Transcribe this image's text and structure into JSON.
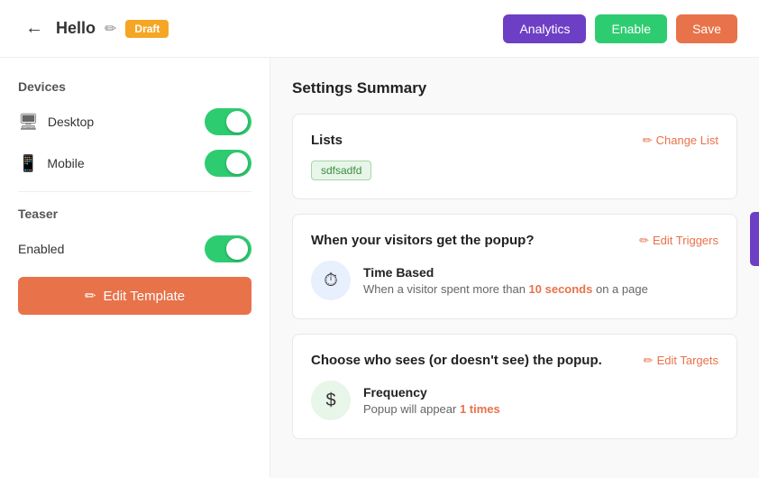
{
  "header": {
    "back_label": "←",
    "title": "Hello",
    "pencil_icon": "✏",
    "draft_badge": "Draft",
    "analytics_label": "Analytics",
    "enable_label": "Enable",
    "save_label": "Save"
  },
  "sidebar": {
    "devices_title": "Devices",
    "desktop_label": "Desktop",
    "mobile_label": "Mobile",
    "teaser_title": "Teaser",
    "teaser_enabled_label": "Enabled",
    "edit_template_label": "Edit Template",
    "pencil_icon": "✏"
  },
  "main": {
    "settings_title": "Settings Summary",
    "lists_card": {
      "title": "Lists",
      "action_label": "Change List",
      "action_icon": "✏",
      "tag": "sdfsadfd"
    },
    "trigger_card": {
      "title": "When your visitors get the popup?",
      "action_label": "Edit Triggers",
      "action_icon": "✏",
      "trigger_name": "Time Based",
      "trigger_desc_prefix": "When a visitor spent more than ",
      "trigger_highlight": "10 seconds",
      "trigger_desc_suffix": " on a page",
      "trigger_icon": "⏱"
    },
    "target_card": {
      "title": "Choose who sees (or doesn't see) the popup.",
      "action_label": "Edit Targets",
      "action_icon": "✏",
      "trigger_name": "Frequency",
      "trigger_desc_prefix": "Popup will appear ",
      "trigger_highlight": "1 times",
      "trigger_icon": "$"
    }
  }
}
